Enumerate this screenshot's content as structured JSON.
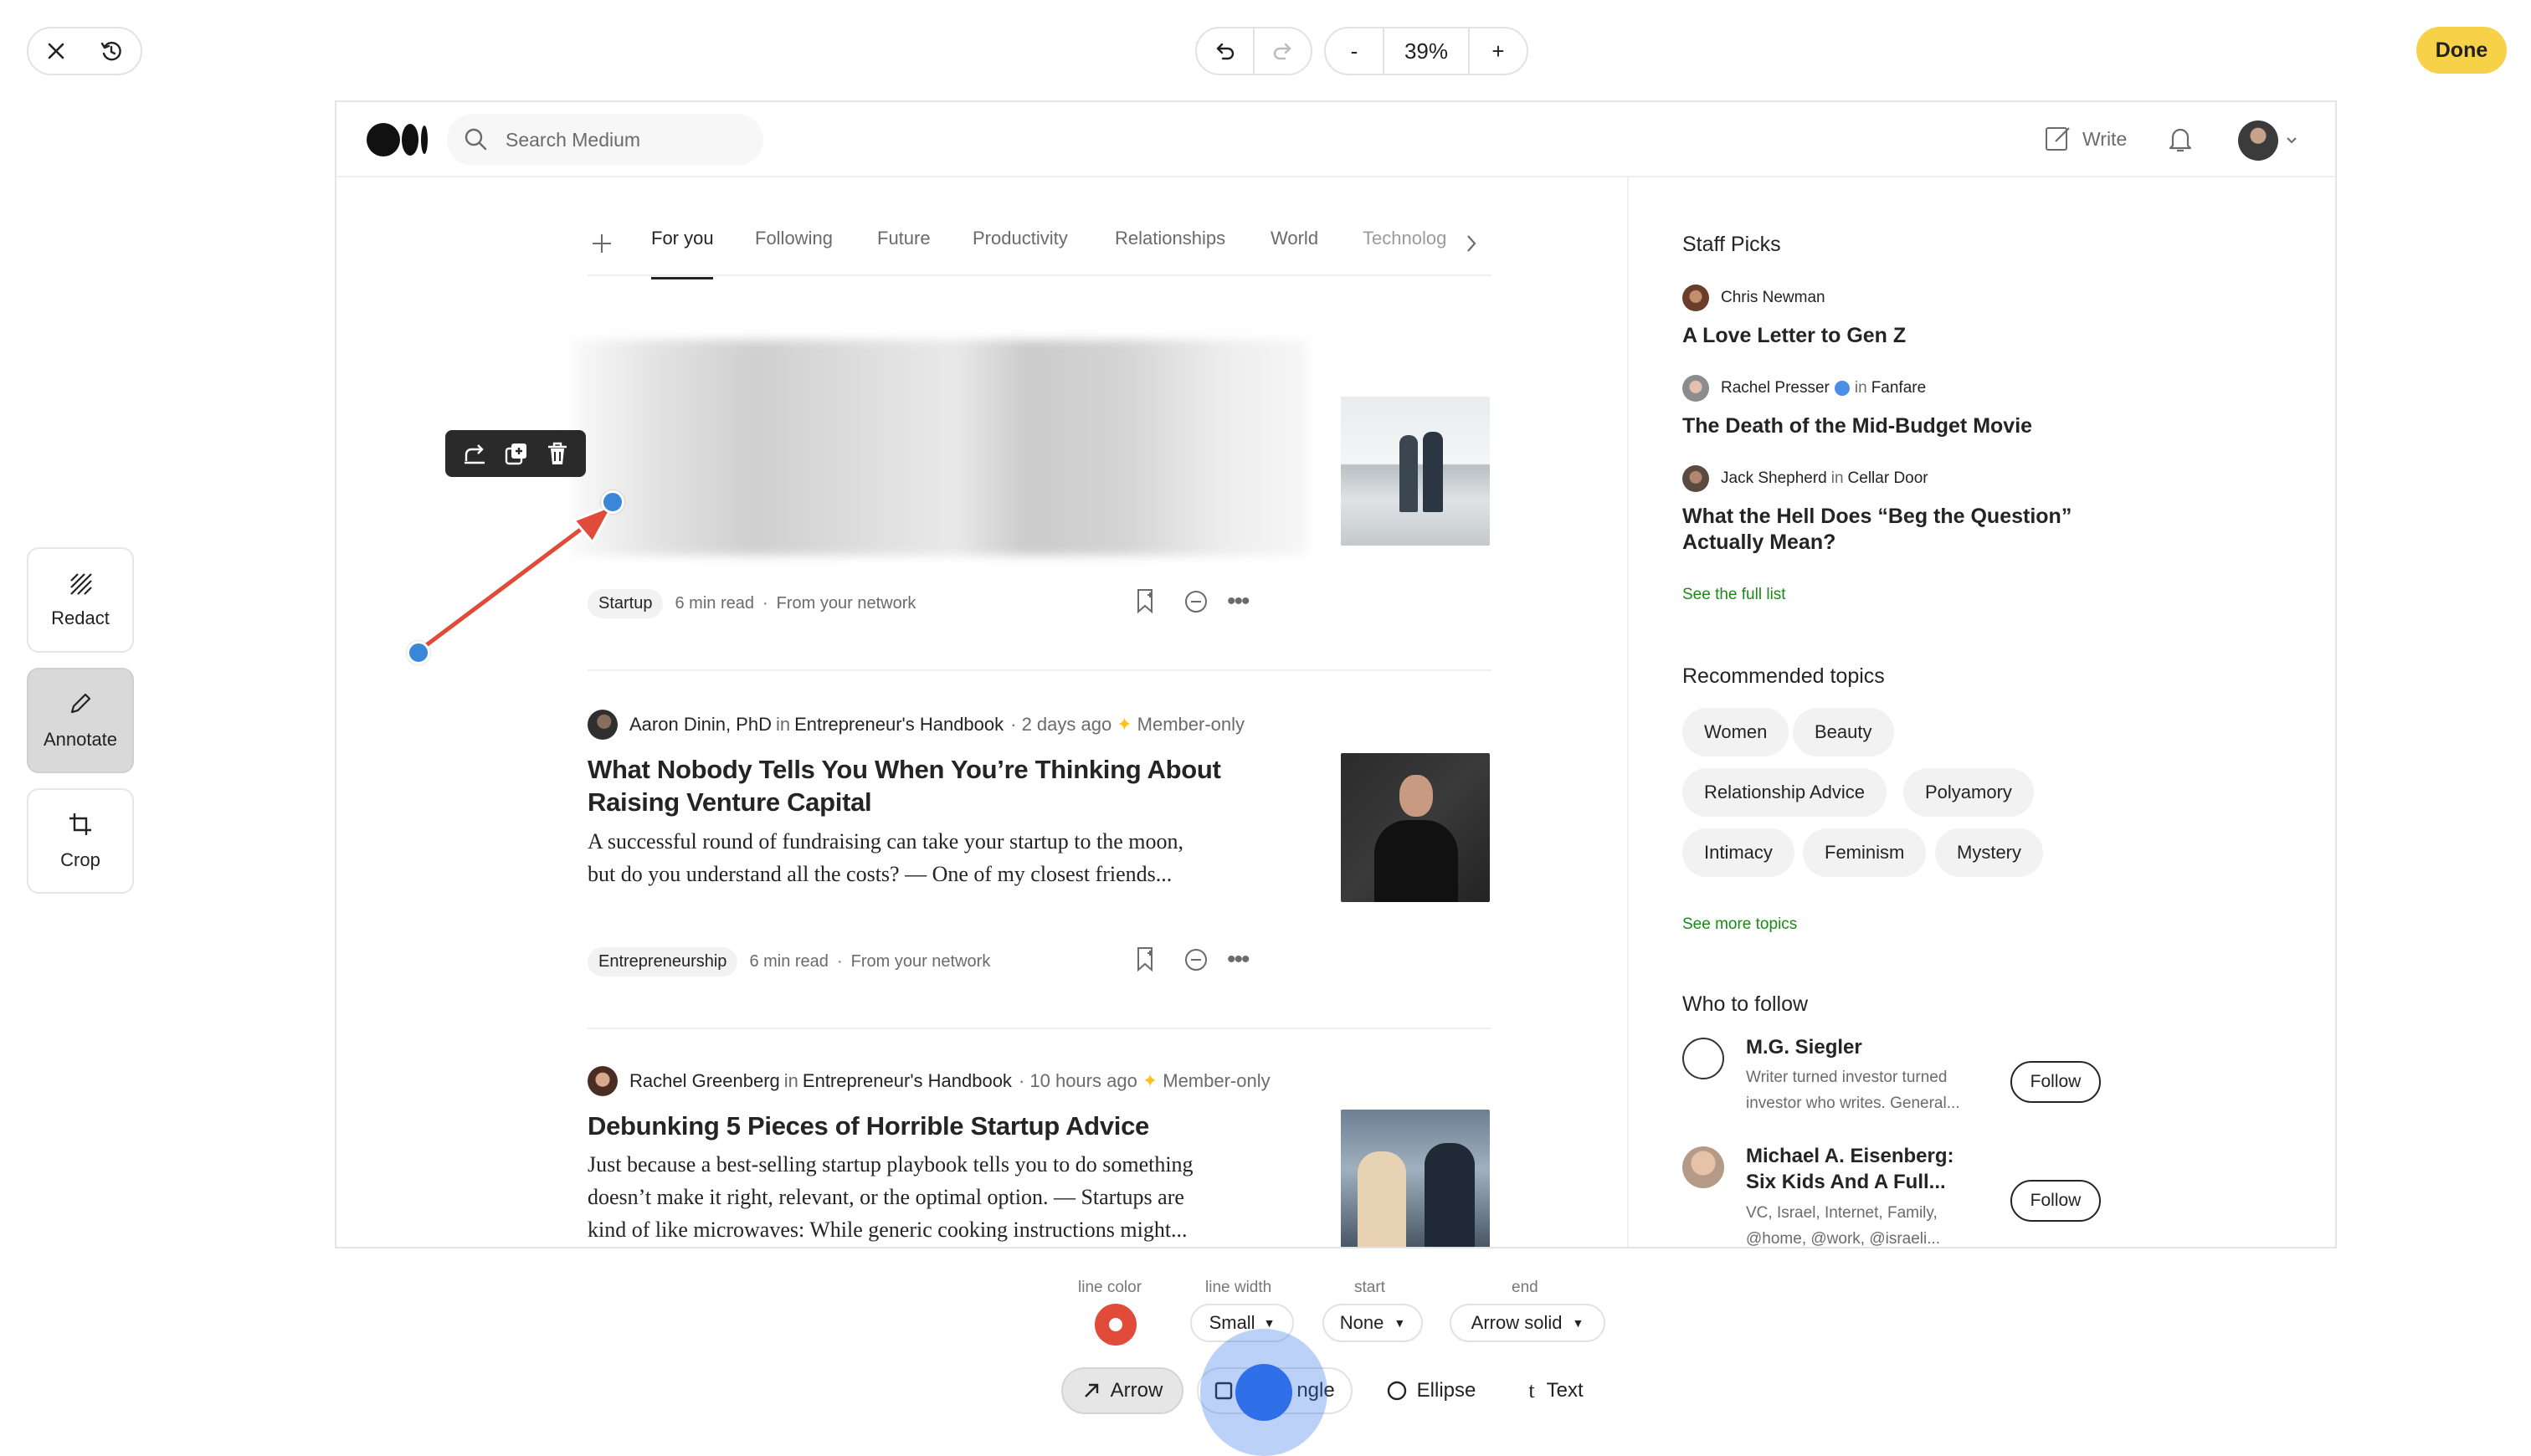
{
  "topbar": {
    "zoom": "39%",
    "zoom_out_label": "-",
    "zoom_in_label": "+",
    "done_label": "Done"
  },
  "tools": {
    "redact": "Redact",
    "annotate": "Annotate",
    "crop": "Crop"
  },
  "medium": {
    "search_placeholder": "Search Medium",
    "write_label": "Write",
    "tabs": [
      "For you",
      "Following",
      "Future",
      "Productivity",
      "Relationships",
      "World",
      "Technolog"
    ],
    "first_post": {
      "tag": "Startup",
      "read_time": "6 min read",
      "source": "From your network"
    },
    "posts": [
      {
        "author": "Aaron Dinin, PhD",
        "in_word": "in",
        "publication": "Entrepreneur's Handbook",
        "when": "· 2 days ago",
        "member": "Member-only",
        "title_line1": "What Nobody Tells You When You’re Thinking About",
        "title_line2": "Raising Venture Capital",
        "excerpt_line1": "A successful round of fundraising can take your startup to the moon,",
        "excerpt_line2": "but do you understand all the costs? — One of my closest friends...",
        "tag": "Entrepreneurship",
        "read_time": "6 min read",
        "source": "From your network"
      },
      {
        "author": "Rachel Greenberg",
        "in_word": "in",
        "publication": "Entrepreneur's Handbook",
        "when": "· 10 hours ago",
        "member": "Member-only",
        "title_line1": "Debunking 5 Pieces of Horrible Startup Advice",
        "excerpt_line1": "Just because a best-selling startup playbook tells you to do something",
        "excerpt_line2": "doesn’t make it right, relevant, or the optimal option. — Startups are",
        "excerpt_line3": "kind of like microwaves: While generic cooking instructions might..."
      }
    ],
    "staff_picks": {
      "heading": "Staff Picks",
      "items": [
        {
          "author": "Chris Newman",
          "in_word": "",
          "publication": "",
          "title_line1": "A Love Letter to Gen Z",
          "title_line2": ""
        },
        {
          "author": "Rachel Presser",
          "in_word": "in",
          "publication": "Fanfare",
          "title_line1": "The Death of the Mid-Budget Movie",
          "title_line2": ""
        },
        {
          "author": "Jack Shepherd",
          "in_word": "in",
          "publication": "Cellar Door",
          "title_line1": "What the Hell Does “Beg the Question”",
          "title_line2": "Actually Mean?"
        }
      ],
      "see_full": "See the full list"
    },
    "topics": {
      "heading": "Recommended topics",
      "chips": [
        "Women",
        "Beauty",
        "Relationship Advice",
        "Polyamory",
        "Intimacy",
        "Feminism",
        "Mystery"
      ],
      "see_more": "See more topics"
    },
    "who_to_follow": {
      "heading": "Who to follow",
      "people": [
        {
          "name_line1": "M.G. Siegler",
          "name_line2": "",
          "desc_line1": "Writer turned investor turned",
          "desc_line2": "investor who writes. General...",
          "desc_line3": "",
          "follow": "Follow"
        },
        {
          "name_line1": "Michael A. Eisenberg:",
          "name_line2": "Six Kids And A Full...",
          "desc_line1": "VC, Israel, Internet, Family,",
          "desc_line2": "@home, @work, @israeli...",
          "desc_line3": "",
          "follow": "Follow"
        }
      ]
    }
  },
  "annotation_toolbar": {
    "line_color_label": "line color",
    "line_width_label": "line width",
    "start_label": "start",
    "end_label": "end",
    "line_width_value": "Small",
    "start_value": "None",
    "end_value": "Arrow solid",
    "shapes": {
      "arrow": "Arrow",
      "rectangle_visible": "ngle",
      "ellipse": "Ellipse",
      "text": "Text"
    }
  },
  "colors": {
    "accent_yellow": "#f7d147",
    "arrow_red": "#e04b3a",
    "handle_blue": "#3a86d8",
    "medium_green": "#1a8917",
    "cursor_blue": "#2f6fe8"
  }
}
